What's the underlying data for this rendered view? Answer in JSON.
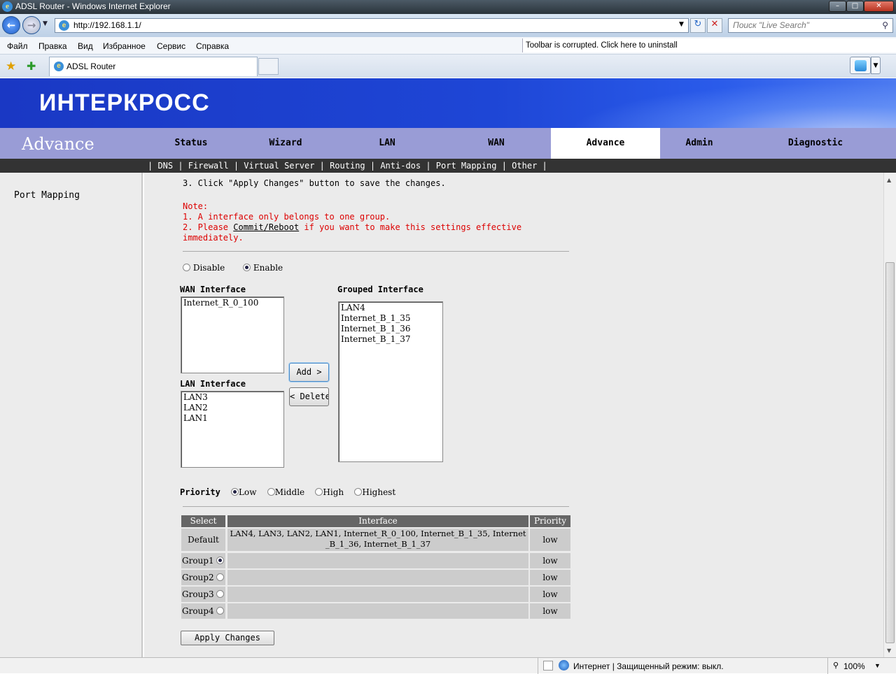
{
  "window": {
    "title": "ADSL Router - Windows Internet Explorer"
  },
  "browser": {
    "address": "http://192.168.1.1/",
    "search_placeholder": "Поиск \"Live Search\"",
    "menu": [
      "Файл",
      "Правка",
      "Вид",
      "Избранное",
      "Сервис",
      "Справка"
    ],
    "toolbar_message": "Toolbar is corrupted. Click here to uninstall",
    "tab_title": "ADSL Router"
  },
  "router": {
    "brand": "ИНТЕРКРОСС",
    "section_title": "Advance",
    "nav": [
      "Status",
      "Wizard",
      "LAN",
      "WAN",
      "Advance",
      "Admin",
      "Diagnostic"
    ],
    "subnav": "| DNS | Firewall | Virtual Server | Routing | Anti-dos | Port Mapping | Other |",
    "left_item": "Port Mapping"
  },
  "content": {
    "step3": "3. Click \"Apply Changes\" button to save the changes.",
    "note_label": "Note:",
    "note1": "1. A interface only belongs to one group.",
    "note2_pre": "2. Please ",
    "note2_link": "Commit/Reboot",
    "note2_post": " if you want to make this settings effective",
    "note2_cont": "immediately.",
    "mode": {
      "disable": "Disable",
      "enable": "Enable",
      "selected": "Enable"
    },
    "wan_label": "WAN Interface",
    "wan_items": [
      "Internet_R_0_100"
    ],
    "lan_label": "LAN Interface",
    "lan_items": [
      "LAN3",
      "LAN2",
      "LAN1"
    ],
    "grouped_label": "Grouped Interface",
    "grouped_items": [
      "LAN4",
      "Internet_B_1_35",
      "Internet_B_1_36",
      "Internet_B_1_37"
    ],
    "add_btn": "Add >",
    "delete_btn": "< Delete",
    "priority_label": "Priority",
    "priorities": [
      "Low",
      "Middle",
      "High",
      "Highest"
    ],
    "priority_selected": "Low",
    "table": {
      "headers": [
        "Select",
        "Interface",
        "Priority"
      ],
      "default_label": "Default",
      "default_iface_1": "LAN4, LAN3, LAN2, LAN1, Internet_R_0_100, Internet_B_1_35, Internet",
      "default_iface_2": "_B_1_36, Internet_B_1_37",
      "default_priority": "low",
      "groups": [
        {
          "name": "Group1",
          "priority": "low",
          "selected": true
        },
        {
          "name": "Group2",
          "priority": "low",
          "selected": false
        },
        {
          "name": "Group3",
          "priority": "low",
          "selected": false
        },
        {
          "name": "Group4",
          "priority": "low",
          "selected": false
        }
      ]
    },
    "apply_btn": "Apply Changes"
  },
  "statusbar": {
    "zone": "Интернет | Защищенный режим: выкл.",
    "zoom": "100%"
  }
}
